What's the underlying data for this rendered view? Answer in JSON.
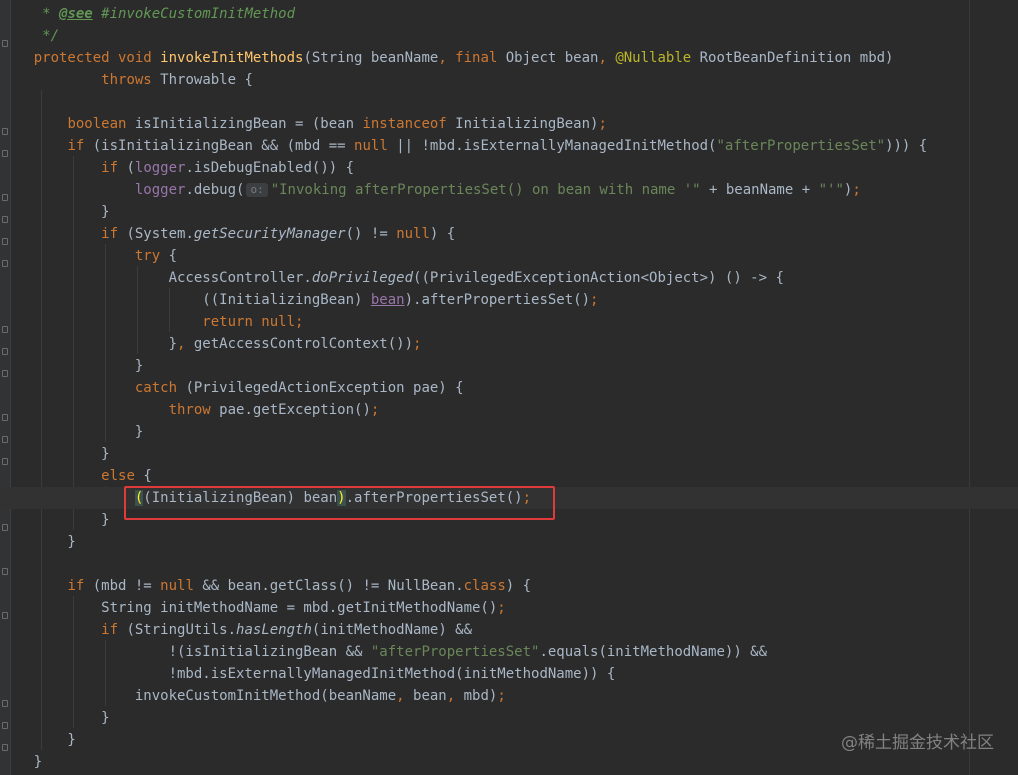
{
  "code_lines": [
    "  * @see #invokeCustomInitMethod",
    "  */",
    "protected void invokeInitMethods(String beanName, final Object bean, @Nullable RootBeanDefinition mbd)",
    "        throws Throwable {",
    "",
    "    boolean isInitializingBean = (bean instanceof InitializingBean);",
    "    if (isInitializingBean && (mbd == null || !mbd.isExternallyManagedInitMethod(\"afterPropertiesSet\"))) {",
    "        if (logger.isDebugEnabled()) {",
    "            logger.debug( o: \"Invoking afterPropertiesSet() on bean with name '\" + beanName + \"'\");",
    "        }",
    "        if (System.getSecurityManager() != null) {",
    "            try {",
    "                AccessController.doPrivileged((PrivilegedExceptionAction<Object>) () -> {",
    "                    ((InitializingBean) bean).afterPropertiesSet();",
    "                    return null;",
    "                }, getAccessControlContext());",
    "            }",
    "            catch (PrivilegedActionException pae) {",
    "                throw pae.getException();",
    "            }",
    "        }",
    "        else {",
    "            ((InitializingBean) bean).afterPropertiesSet();",
    "        }",
    "    }",
    "",
    "    if (mbd != null && bean.getClass() != NullBean.class) {",
    "        String initMethodName = mbd.getInitMethodName();",
    "        if (StringUtils.hasLength(initMethodName) &&",
    "                !(isInitializingBean && \"afterPropertiesSet\".equals(initMethodName)) &&",
    "                !mbd.isExternallyManagedInitMethod(initMethodName)) {",
    "            invokeCustomInitMethod(beanName, bean, mbd);",
    "        }",
    "    }",
    "}"
  ],
  "watermark": "@稀土掘金技术社区",
  "colors": {
    "background": "#2b2b2b",
    "keyword": "#cc7832",
    "method": "#ffc66d",
    "string": "#6a8759",
    "annotation": "#bbb529",
    "field": "#9876aa",
    "highlight_box": "#e03a3a"
  }
}
